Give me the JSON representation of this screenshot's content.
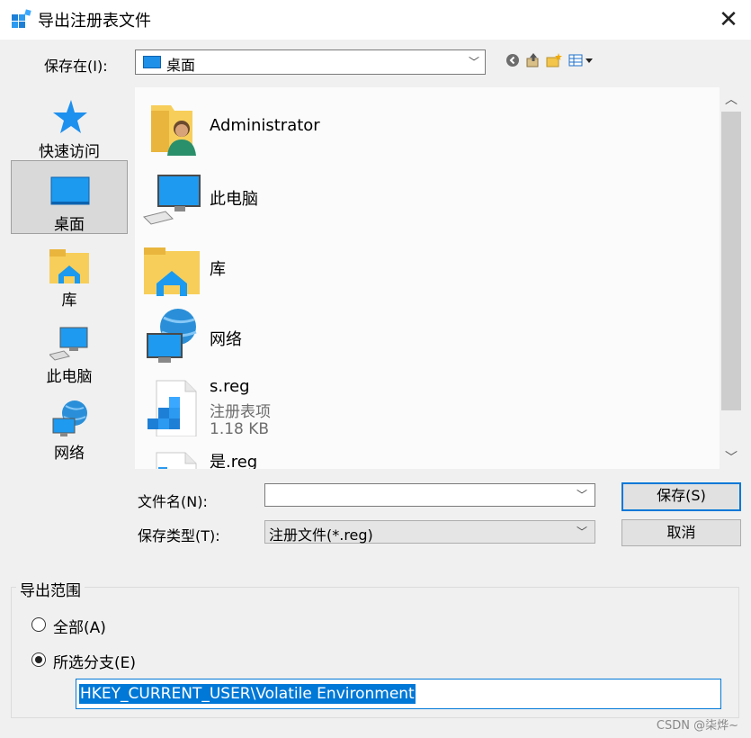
{
  "window": {
    "title": "导出注册表文件",
    "close_glyph": "✕"
  },
  "save_in": {
    "label": "保存在(I):",
    "value": "桌面"
  },
  "places": [
    {
      "label": "快速访问",
      "icon": "star-icon"
    },
    {
      "label": "桌面",
      "icon": "desktop-icon",
      "selected": true
    },
    {
      "label": "库",
      "icon": "library-icon"
    },
    {
      "label": "此电脑",
      "icon": "computer-icon"
    },
    {
      "label": "网络",
      "icon": "network-icon"
    }
  ],
  "files": [
    {
      "name": "Administrator",
      "icon": "user-folder-icon"
    },
    {
      "name": "此电脑",
      "icon": "computer-icon"
    },
    {
      "name": "库",
      "icon": "library-icon"
    },
    {
      "name": "网络",
      "icon": "network-icon"
    },
    {
      "name": "s.reg",
      "type": "注册表项",
      "size": "1.18 KB",
      "icon": "registry-file-icon"
    },
    {
      "name": "是.reg",
      "icon": "registry-file-icon"
    }
  ],
  "filename": {
    "label": "文件名(N):",
    "value": ""
  },
  "filetype": {
    "label": "保存类型(T):",
    "value": "注册文件(*.reg)"
  },
  "buttons": {
    "save": "保存(S)",
    "cancel": "取消"
  },
  "export_range": {
    "title": "导出范围",
    "all_label": "全部(A)",
    "branch_label": "所选分支(E)",
    "selected_option": "branch",
    "branch_value": "HKEY_CURRENT_USER\\Volatile Environment"
  },
  "watermark": "CSDN @柒烨~",
  "colors": {
    "accent": "#0078d7",
    "selection_bg": "#0078d7"
  }
}
